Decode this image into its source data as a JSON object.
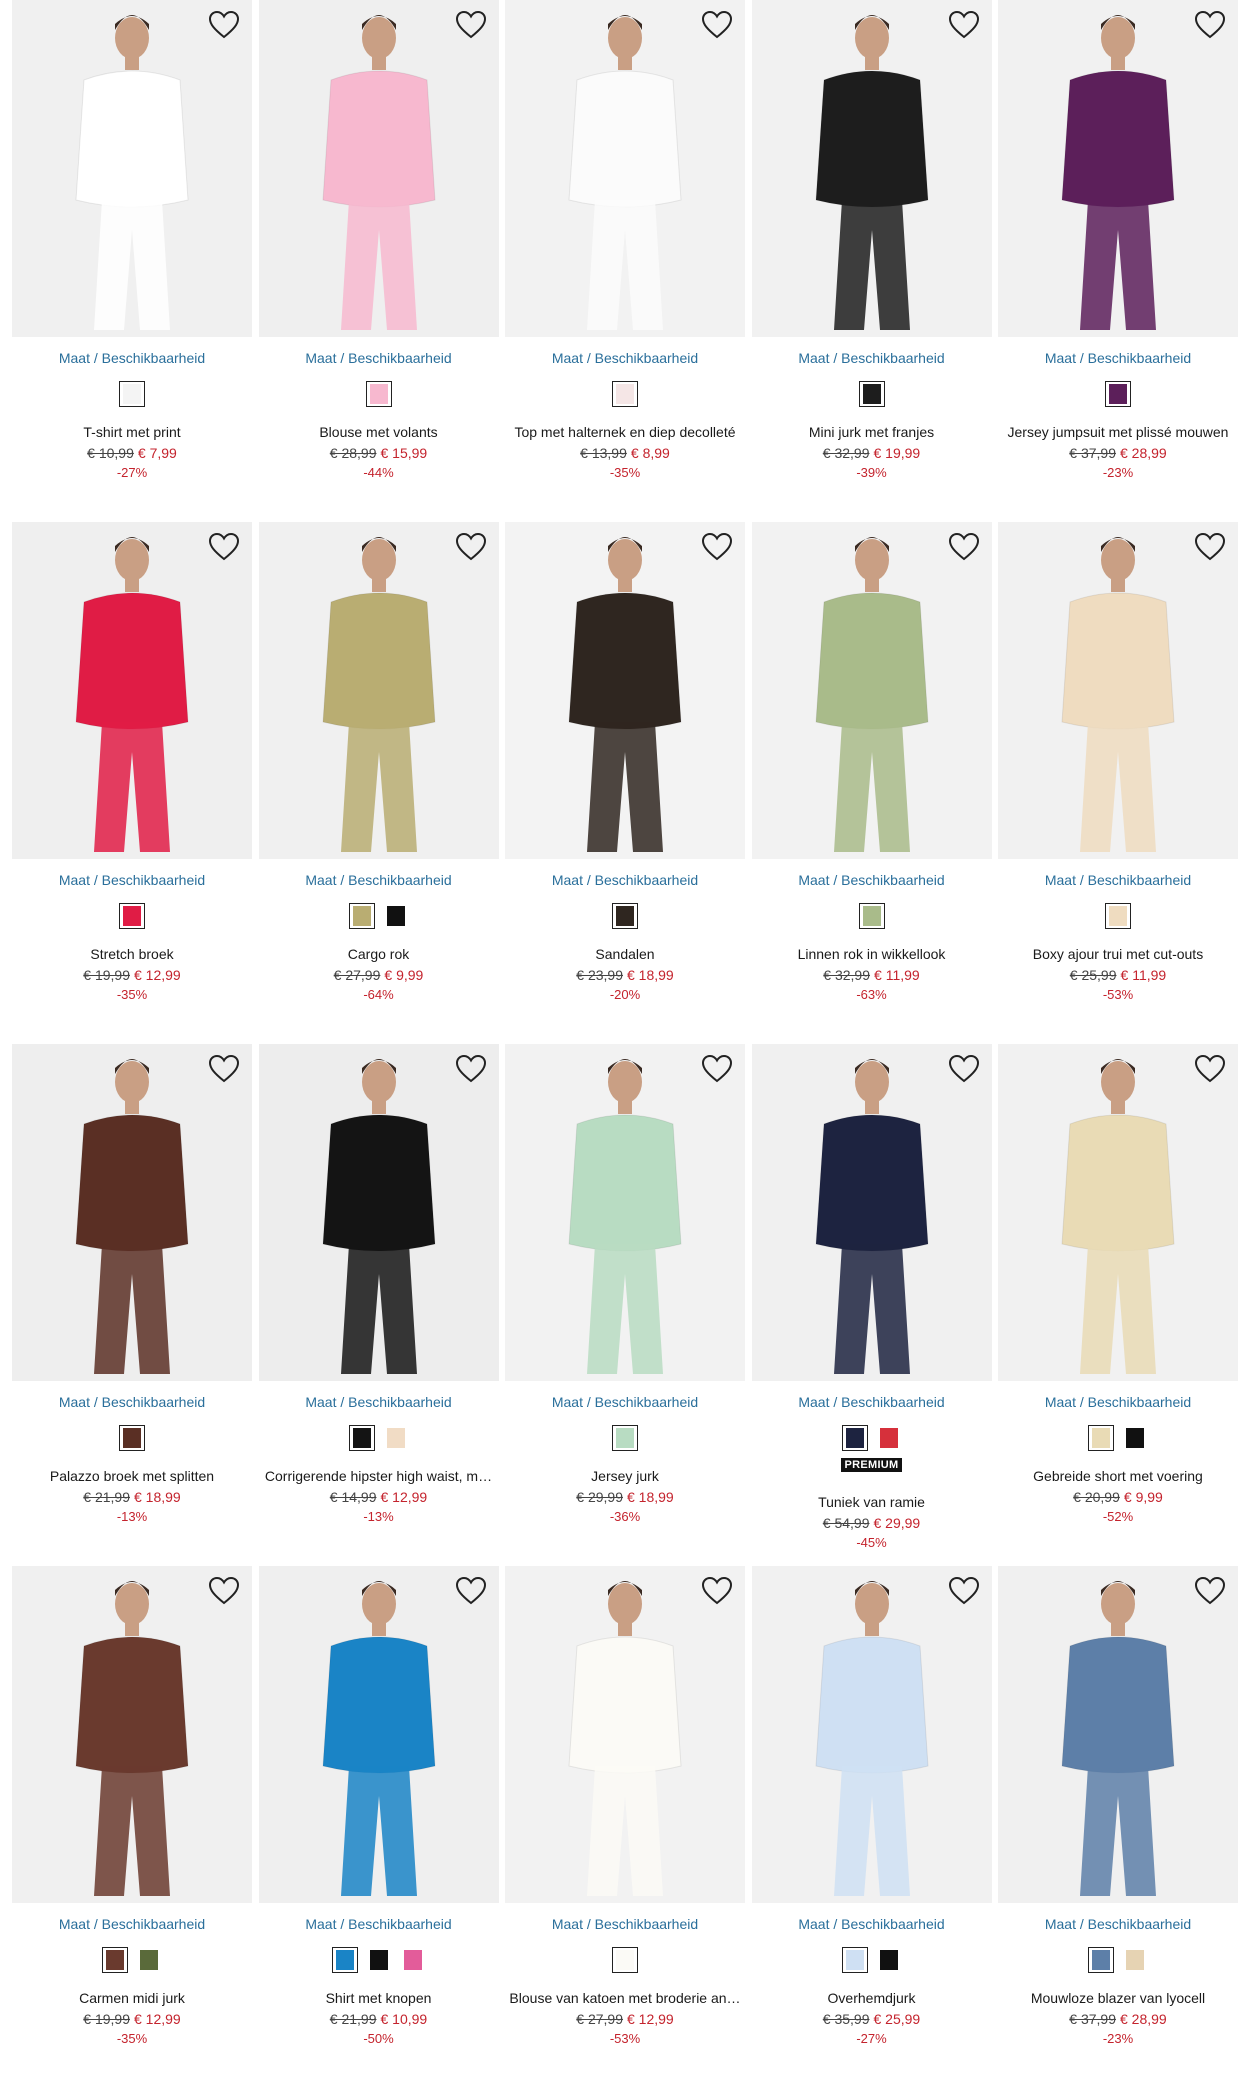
{
  "size_link_label": "Maat / Beschikbaarheid",
  "colors": {
    "price_sale": "#c4232d",
    "link": "#2a6f9b"
  },
  "products": [
    {
      "name": "T-shirt met print",
      "old_price": "€ 10,99",
      "new_price": "€ 7,99",
      "discount": "-27%",
      "bg": "#f0f0f0",
      "garment": "#ffffff",
      "swatches": [
        "#f4f4f4"
      ]
    },
    {
      "name": "Blouse met volants",
      "old_price": "€ 28,99",
      "new_price": "€ 15,99",
      "discount": "-44%",
      "bg": "#efefef",
      "garment": "#f7b8cf",
      "swatches": [
        "#f7b8cf"
      ]
    },
    {
      "name": "Top met halternek en diep decolleté",
      "old_price": "€ 13,99",
      "new_price": "€ 8,99",
      "discount": "-35%",
      "bg": "#f2f2f2",
      "garment": "#fbfbfb",
      "swatches": [
        "#f5e6e6"
      ]
    },
    {
      "name": "Mini jurk met franjes",
      "old_price": "€ 32,99",
      "new_price": "€ 19,99",
      "discount": "-39%",
      "bg": "#f1f1f1",
      "garment": "#1d1d1d",
      "swatches": [
        "#1d1d1d"
      ]
    },
    {
      "name": "Jersey jumpsuit met plissé mouwen",
      "old_price": "€ 37,99",
      "new_price": "€ 28,99",
      "discount": "-23%",
      "bg": "#f1f1f1",
      "garment": "#5c1f5a",
      "swatches": [
        "#5c1f5a"
      ]
    },
    {
      "name": "Stretch broek",
      "old_price": "€ 19,99",
      "new_price": "€ 12,99",
      "discount": "-35%",
      "bg": "#efefef",
      "garment": "#e01c45",
      "swatches": [
        "#e01c45"
      ]
    },
    {
      "name": "Cargo rok",
      "old_price": "€ 27,99",
      "new_price": "€ 9,99",
      "discount": "-64%",
      "bg": "#f0f0f0",
      "garment": "#b9ad72",
      "swatches": [
        "#b9ad72",
        "#111111"
      ]
    },
    {
      "name": "Sandalen",
      "old_price": "€ 23,99",
      "new_price": "€ 18,99",
      "discount": "-20%",
      "bg": "#f3f3f3",
      "garment": "#2f2620",
      "swatches": [
        "#2f2620"
      ]
    },
    {
      "name": "Linnen rok in wikkellook",
      "old_price": "€ 32,99",
      "new_price": "€ 11,99",
      "discount": "-63%",
      "bg": "#f2f2f2",
      "garment": "#a9bb8a",
      "swatches": [
        "#a9bb8a"
      ]
    },
    {
      "name": "Boxy ajour trui met cut-outs",
      "old_price": "€ 25,99",
      "new_price": "€ 11,99",
      "discount": "-53%",
      "bg": "#f1f1f1",
      "garment": "#efdcc0",
      "swatches": [
        "#efdcc0"
      ]
    },
    {
      "name": "Palazzo broek met splitten",
      "old_price": "€ 21,99",
      "new_price": "€ 18,99",
      "discount": "-13%",
      "bg": "#eeeeee",
      "garment": "#5a2f24",
      "swatches": [
        "#5a2f24"
      ]
    },
    {
      "name": "Corrigerende hipster high waist, m…",
      "old_price": "€ 14,99",
      "new_price": "€ 12,99",
      "discount": "-13%",
      "bg": "#ededed",
      "garment": "#141414",
      "swatches": [
        "#141414",
        "#f1dcc5"
      ]
    },
    {
      "name": "Jersey jurk",
      "old_price": "€ 29,99",
      "new_price": "€ 18,99",
      "discount": "-36%",
      "bg": "#f2f2f2",
      "garment": "#b8dcc2",
      "swatches": [
        "#b8dcc2"
      ]
    },
    {
      "name": "Tuniek van ramie",
      "old_price": "€ 54,99",
      "new_price": "€ 29,99",
      "discount": "-45%",
      "bg": "#f0f0f0",
      "garment": "#1d2340",
      "swatches": [
        "#1d2340",
        "#d6303b"
      ],
      "badge": "PREMIUM"
    },
    {
      "name": "Gebreide short met voering",
      "old_price": "€ 20,99",
      "new_price": "€ 9,99",
      "discount": "-52%",
      "bg": "#f1f1f1",
      "garment": "#e9dbb5",
      "swatches": [
        "#e9dbb5",
        "#111111"
      ]
    },
    {
      "name": "Carmen midi jurk",
      "old_price": "€ 19,99",
      "new_price": "€ 12,99",
      "discount": "-35%",
      "bg": "#f0f0f0",
      "garment": "#6a3a2e",
      "swatches": [
        "#6a3a2e",
        "#5a6a3a"
      ]
    },
    {
      "name": "Shirt met knopen",
      "old_price": "€ 21,99",
      "new_price": "€ 10,99",
      "discount": "-50%",
      "bg": "#efefef",
      "garment": "#1a84c6",
      "swatches": [
        "#1a84c6",
        "#111111",
        "#e35c9a"
      ]
    },
    {
      "name": "Blouse van katoen met broderie an…",
      "old_price": "€ 27,99",
      "new_price": "€ 12,99",
      "discount": "-53%",
      "bg": "#f2f2f2",
      "garment": "#fbfaf6",
      "swatches": [
        "#fbfaf6"
      ]
    },
    {
      "name": "Overhemdjurk",
      "old_price": "€ 35,99",
      "new_price": "€ 25,99",
      "discount": "-27%",
      "bg": "#f1f1f1",
      "garment": "#cfe0f3",
      "swatches": [
        "#cfe0f3",
        "#111111"
      ]
    },
    {
      "name": "Mouwloze blazer van lyocell",
      "old_price": "€ 37,99",
      "new_price": "€ 28,99",
      "discount": "-23%",
      "bg": "#f0f0f0",
      "garment": "#5d7fa8",
      "swatches": [
        "#5d7fa8",
        "#e6d3b3"
      ]
    }
  ]
}
